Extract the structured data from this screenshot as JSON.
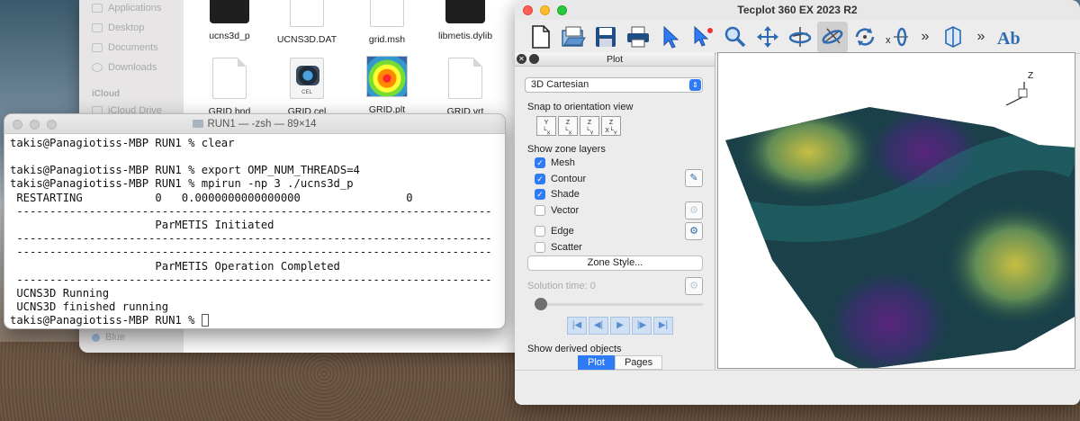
{
  "finder": {
    "sidebar": {
      "items": [
        "Applications",
        "Desktop",
        "Documents",
        "Downloads"
      ],
      "icloud_heading": "iCloud",
      "icloud_items": [
        "iCloud Drive"
      ],
      "tag": "Blue"
    },
    "files": [
      {
        "name": "ucns3d_p",
        "kind": "exec"
      },
      {
        "name": "UCNS3D.DAT",
        "kind": "doc"
      },
      {
        "name": "grid.msh",
        "kind": "doc"
      },
      {
        "name": "libmetis.dylib",
        "kind": "exec"
      },
      {
        "name": "GRID.bnd",
        "kind": "doc"
      },
      {
        "name": "GRID.cel",
        "kind": "cel"
      },
      {
        "name": "GRID.plt",
        "kind": "plt"
      },
      {
        "name": "GRID.vrt",
        "kind": "doc"
      }
    ],
    "cel_icon_text": "CEL"
  },
  "terminal": {
    "title": "RUN1 — -zsh — 89×14",
    "lines": [
      "takis@Panagiotiss-MBP RUN1 % clear",
      "",
      "takis@Panagiotiss-MBP RUN1 % export OMP_NUM_THREADS=4",
      "takis@Panagiotiss-MBP RUN1 % mpirun -np 3 ./ucns3d_p",
      " RESTARTING           0   0.0000000000000000                0",
      " ------------------------------------------------------------------------",
      "                      ParMETIS Initiated",
      " ------------------------------------------------------------------------",
      " ------------------------------------------------------------------------",
      "                      ParMETIS Operation Completed",
      " ------------------------------------------------------------------------",
      " UCNS3D Running",
      " UCNS3D finished running",
      "takis@Panagiotiss-MBP RUN1 % "
    ]
  },
  "tecplot": {
    "title": "Tecplot 360 EX 2023 R2",
    "toolbar_icons": [
      "new-file-icon",
      "open-file-icon",
      "save-icon",
      "print-icon",
      "select-arrow-icon",
      "probe-arrow-icon",
      "zoom-icon",
      "translate-icon",
      "rotate-axis-icon",
      "rotate-free-icon",
      "rotate-spherical-icon",
      "rotate-x-icon",
      "more-icon",
      "slice-icon",
      "more-icon",
      "text-icon"
    ],
    "panel": {
      "title": "Plot",
      "plot_type": "3D Cartesian",
      "snap_label": "Snap to orientation view",
      "snap_buttons": [
        "Y/X",
        "Z/X",
        "Z/Y",
        "X/Y/Z"
      ],
      "zone_layers_label": "Show zone layers",
      "layers": [
        {
          "label": "Mesh",
          "checked": true
        },
        {
          "label": "Contour",
          "checked": true
        },
        {
          "label": "Shade",
          "checked": true
        },
        {
          "label": "Vector",
          "checked": false
        },
        {
          "label": "Edge",
          "checked": false
        },
        {
          "label": "Scatter",
          "checked": false
        }
      ],
      "zone_style_button": "Zone Style...",
      "solution_time_label": "Solution time: 0",
      "derived_label": "Show derived objects",
      "tabs": [
        "Plot",
        "Pages"
      ],
      "selected_tab": "Plot"
    },
    "axis_label": "Z",
    "surface_colors": [
      "#3a1550",
      "#0d3d4a",
      "#1f6a6a",
      "#b8b23a"
    ]
  }
}
